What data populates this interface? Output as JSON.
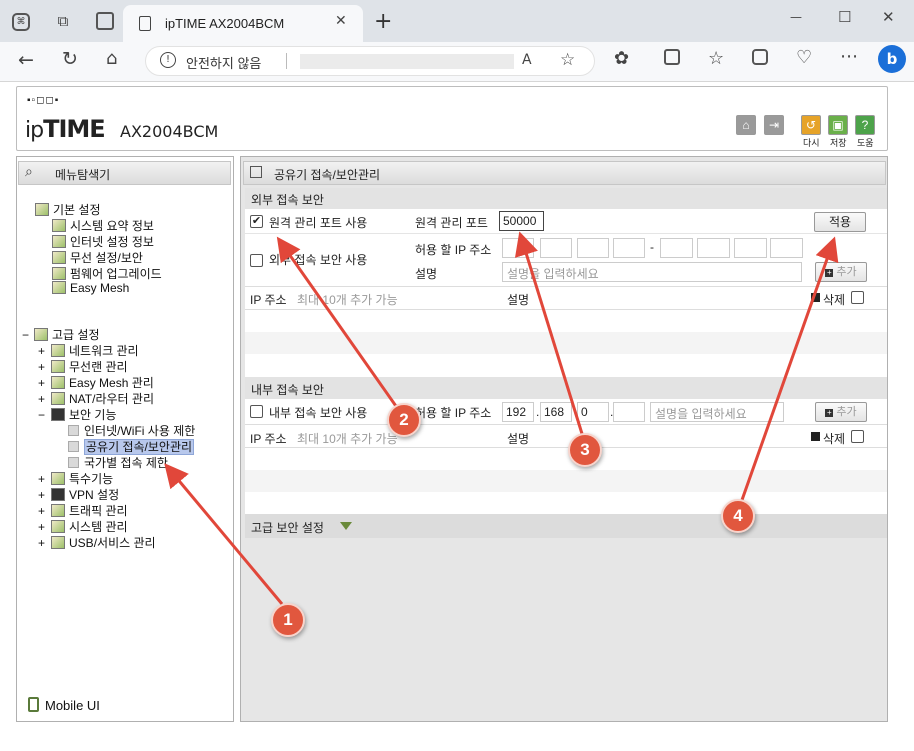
{
  "browser": {
    "tab_title": "ipTIME AX2004BCM",
    "new_tab": "+",
    "security_label": "안전하지 않음",
    "window_controls": [
      "—",
      "☐",
      "✕"
    ]
  },
  "router": {
    "brand": "ipTIME",
    "model": "AX2004BCM",
    "header_buttons": [
      {
        "label": "다시"
      },
      {
        "label": "저장"
      },
      {
        "label": "도움"
      }
    ]
  },
  "sidebar": {
    "title": "메뉴탐색기",
    "basic": {
      "label": "기본 설정",
      "items": [
        "시스템 요약 정보",
        "인터넷 설정 정보",
        "무선 설정/보안",
        "펌웨어 업그레이드",
        "Easy Mesh"
      ]
    },
    "advanced": {
      "label": "고급 설정",
      "items": [
        "네트워크 관리",
        "무선랜 관리",
        "Easy Mesh 관리",
        "NAT/라우터 관리"
      ]
    },
    "security": {
      "label": "보안 기능",
      "items": [
        "인터넷/WiFi 사용 제한",
        "공유기 접속/보안관리",
        "국가별 접속 제한"
      ]
    },
    "advanced_rest": [
      "특수기능",
      "VPN 설정",
      "트래픽 관리",
      "시스템 관리",
      "USB/서비스 관리"
    ],
    "mobile": "Mobile UI"
  },
  "main": {
    "title": "공유기 접속/보안관리",
    "external": {
      "section": "외부 접속 보안",
      "remote_port_check": "원격 관리 포트 사용",
      "remote_port_label": "원격 관리 포트",
      "remote_port_value": "50000",
      "apply": "적용",
      "ext_security_check": "외부 접속 보안 사용",
      "allow_ip_label": "허용 할 IP 주소",
      "desc_label": "설명",
      "desc_placeholder": "설명을 입력하세요",
      "add": "추가",
      "col_ip": "IP 주소",
      "col_ip_hint": "최대 10개 추가 가능",
      "col_desc": "설명",
      "col_delete": "삭제"
    },
    "internal": {
      "section": "내부 접속 보안",
      "check": "내부 접속 보안 사용",
      "allow_ip_label": "허용 할 IP 주소",
      "ip1": "192",
      "ip2": "168",
      "ip3": "0",
      "ip4": "",
      "desc_placeholder": "설명을 입력하세요",
      "add": "추가",
      "col_ip": "IP 주소",
      "col_ip_hint": "최대 10개 추가 가능",
      "col_desc": "설명",
      "col_delete": "삭제"
    },
    "advanced": "고급 보안 설정"
  },
  "annotations": [
    "1",
    "2",
    "3",
    "4"
  ],
  "colors": {
    "annotation": "#e1573e",
    "selected": "#b8c8ec"
  }
}
